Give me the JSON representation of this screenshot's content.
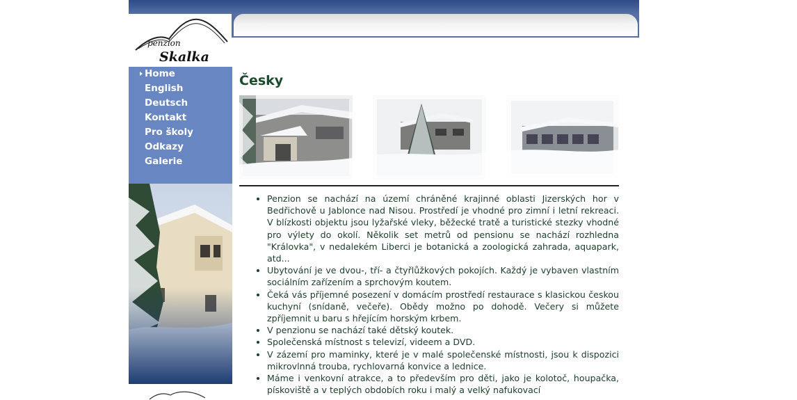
{
  "site": {
    "logo_small": "penzion",
    "logo_big": "Skalka"
  },
  "nav": {
    "items": [
      {
        "label": "Home",
        "active": true
      },
      {
        "label": "English"
      },
      {
        "label": "Deutsch"
      },
      {
        "label": "Kontakt"
      },
      {
        "label": "Pro školy"
      },
      {
        "label": "Odkazy"
      },
      {
        "label": "Galerie"
      }
    ]
  },
  "main": {
    "title": "Česky",
    "paragraphs": [
      "Penzion se nachází na území chráněné krajinné oblasti Jizerských hor v Bedřichově u Jablonce nad Nisou. Prostředí je vhodné pro zimní i letní rekreaci. V blízkosti objektu jsou lyžařské vleky, běžecké tratě a turistické stezky vhodné pro výlety do okolí. Několik set metrů od pensionu se nachází rozhledna \"Královka\", v nedalekém Liberci je botanická a zoologická zahrada, aquapark, atd...",
      "Ubytování je ve dvou-, tří- a čtyřlůžkových pokojích. Každý je vybaven vlastním sociálním zařízením a sprchovým koutem.",
      "Čeká vás příjemné posezení v domácím prostředí restaurace s klasickou českou kuchyní (snídaně, večeře). Obědy možno po dohodě. Večery si můžete zpříjemnit u baru s hřejícím horským krbem.",
      "V penzionu se nachází také dětský koutek.",
      "Společenská místnost s televizí, videem a DVD.",
      "V zázemí pro maminky, které je v malé společenské místnosti, jsou k dispozici mikrovlnná trouba, rychlovarná konvice a lednice.",
      "Máme i venkovní atrakce, a to především pro děti, jako je kolotoč, houpačka, pískoviště a v teplých obdobích roku i malý a velký nafukovací"
    ]
  },
  "colors": {
    "nav_bg": "#6886c2",
    "top_band": "#2d4a86",
    "heading": "#1c4a2c",
    "text": "#1c3d28"
  }
}
